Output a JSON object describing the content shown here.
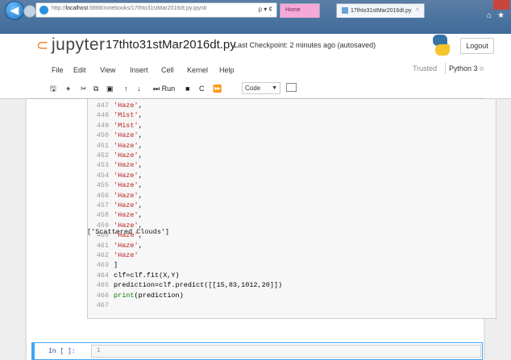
{
  "browser": {
    "url_prefix": "http://",
    "url_host": "localhost",
    "url_rest": ":8888/notebooks/17thto31stMar2016dt.py.ipynb",
    "url_controls": "ρ ▾ ¢",
    "tabs": [
      {
        "label": "Home"
      },
      {
        "label": "17thto31stMar2016dt.py"
      }
    ],
    "tab_close": "×"
  },
  "header": {
    "logo_text": "jupyter",
    "notebook_name": "17thto31stMar2016dt.py",
    "checkpoint": "Last Checkpoint: 2 minutes ago  (autosaved)",
    "logout_label": "Logout"
  },
  "menubar": {
    "items": [
      "File",
      "Edit",
      "View",
      "Insert",
      "Cell",
      "Kernel",
      "Help"
    ],
    "trusted": "Trusted",
    "kernel": "Python 3"
  },
  "toolbar": {
    "run_label": "Run",
    "cell_type": "Code"
  },
  "code_lines": [
    {
      "n": "447",
      "text": "'Haze',"
    },
    {
      "n": "448",
      "text": "'Mist',"
    },
    {
      "n": "449",
      "text": "'Mist',"
    },
    {
      "n": "450",
      "text": "'Haze',"
    },
    {
      "n": "451",
      "text": "'Haze',"
    },
    {
      "n": "452",
      "text": "'Haze',"
    },
    {
      "n": "453",
      "text": "'Haze',"
    },
    {
      "n": "454",
      "text": "'Haze',"
    },
    {
      "n": "455",
      "text": "'Haze',"
    },
    {
      "n": "456",
      "text": "'Haze',"
    },
    {
      "n": "457",
      "text": "'Haze',"
    },
    {
      "n": "458",
      "text": "'Haze',"
    },
    {
      "n": "459",
      "text": "'Haze',"
    },
    {
      "n": "460",
      "text": "'Haze',"
    },
    {
      "n": "461",
      "text": "'Haze',"
    },
    {
      "n": "462",
      "text": "'Haze'"
    },
    {
      "n": "463",
      "text": "]"
    },
    {
      "n": "464",
      "text": "clf=clf.fit(X,Y)"
    },
    {
      "n": "465",
      "text": "prediction=clf.predict([[15,83,1012,20]])"
    },
    {
      "n": "466",
      "text": "print(prediction)"
    },
    {
      "n": "467",
      "text": ""
    }
  ],
  "output_text": "['Scattered Clouds']",
  "next_cell": {
    "prompt": "In [ ]:",
    "line_number": "1"
  }
}
